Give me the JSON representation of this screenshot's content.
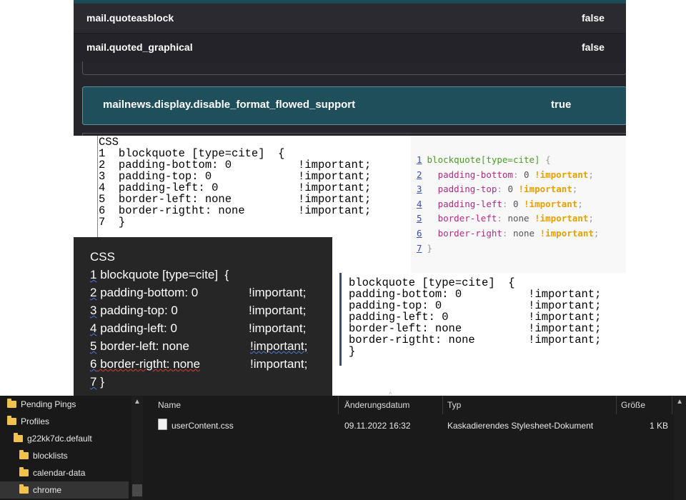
{
  "config_editor": {
    "rows": [
      {
        "name": "mail.quoteasblock",
        "value": "false"
      },
      {
        "name": "mail.quoted_graphical",
        "value": "false"
      }
    ],
    "selected_row": {
      "name": "mailnews.display.disable_format_flowed_support",
      "value": "true"
    }
  },
  "plain_code": {
    "title": "CSS",
    "lines": [
      "1  blockquote [type=cite]  {",
      "2  padding-bottom: 0          !important;",
      "3  padding-top: 0             !important;",
      "4  padding-left: 0            !important;",
      "5  border-left: none          !important;",
      "6  border-rigtht: none        !important;",
      "7  }"
    ]
  },
  "highlighted_code": {
    "selector": "blockquote[type=cite]",
    "decls": [
      {
        "prop": "padding-bottom",
        "val": "0"
      },
      {
        "prop": "padding-top",
        "val": "0"
      },
      {
        "prop": "padding-left",
        "val": "0"
      },
      {
        "prop": "border-left",
        "val": "none"
      },
      {
        "prop": "border-right",
        "val": "none"
      }
    ],
    "important": "!important",
    "open_brace": "{",
    "close_brace": "}",
    "line_numbers": [
      "1",
      "2",
      "3",
      "4",
      "5",
      "6",
      "7"
    ]
  },
  "dark_code": {
    "title": "CSS",
    "lines": [
      {
        "num": "1",
        "text": " blockquote [type=cite]  {",
        "imp": ""
      },
      {
        "num": "2",
        "text": " padding-bottom: 0",
        "imp": "!important;"
      },
      {
        "num": "3",
        "text": " padding-top: 0",
        "imp": "!important;"
      },
      {
        "num": "4",
        "text": " padding-left: 0",
        "imp": "!important;"
      },
      {
        "num": "5",
        "text": " border-left: none",
        "imp": "!important;"
      },
      {
        "num": "6",
        "text": " border-rigtht: none",
        "imp": "!important;"
      },
      {
        "num": "7",
        "text": " }",
        "imp": ""
      }
    ]
  },
  "mono_code": {
    "lines": [
      "blockquote [type=cite]  {",
      "padding-bottom: 0          !important;",
      "padding-top: 0             !important;",
      "padding-left: 0            !important;",
      "border-left: none          !important;",
      "border-rigtht: none        !important;",
      "}"
    ]
  },
  "explorer": {
    "tree": [
      {
        "label": "Pending Pings"
      },
      {
        "label": "Profiles"
      },
      {
        "label": "g22kk7dc.default"
      },
      {
        "label": "blocklists"
      },
      {
        "label": "calendar-data"
      },
      {
        "label": "chrome"
      }
    ],
    "columns": {
      "name": "Name",
      "date": "Änderungsdatum",
      "type": "Typ",
      "size": "Größe"
    },
    "files": [
      {
        "name": "userContent.css",
        "date": "09.11.2022 16:32",
        "type": "Kaskadierendes Stylesheet-Dokument",
        "size": "1 KB"
      }
    ],
    "icons": {
      "folder": "folder-icon",
      "file": "css-file-icon"
    },
    "colors": {
      "folder": "#f2c14e",
      "selected_row": "#343434"
    }
  }
}
